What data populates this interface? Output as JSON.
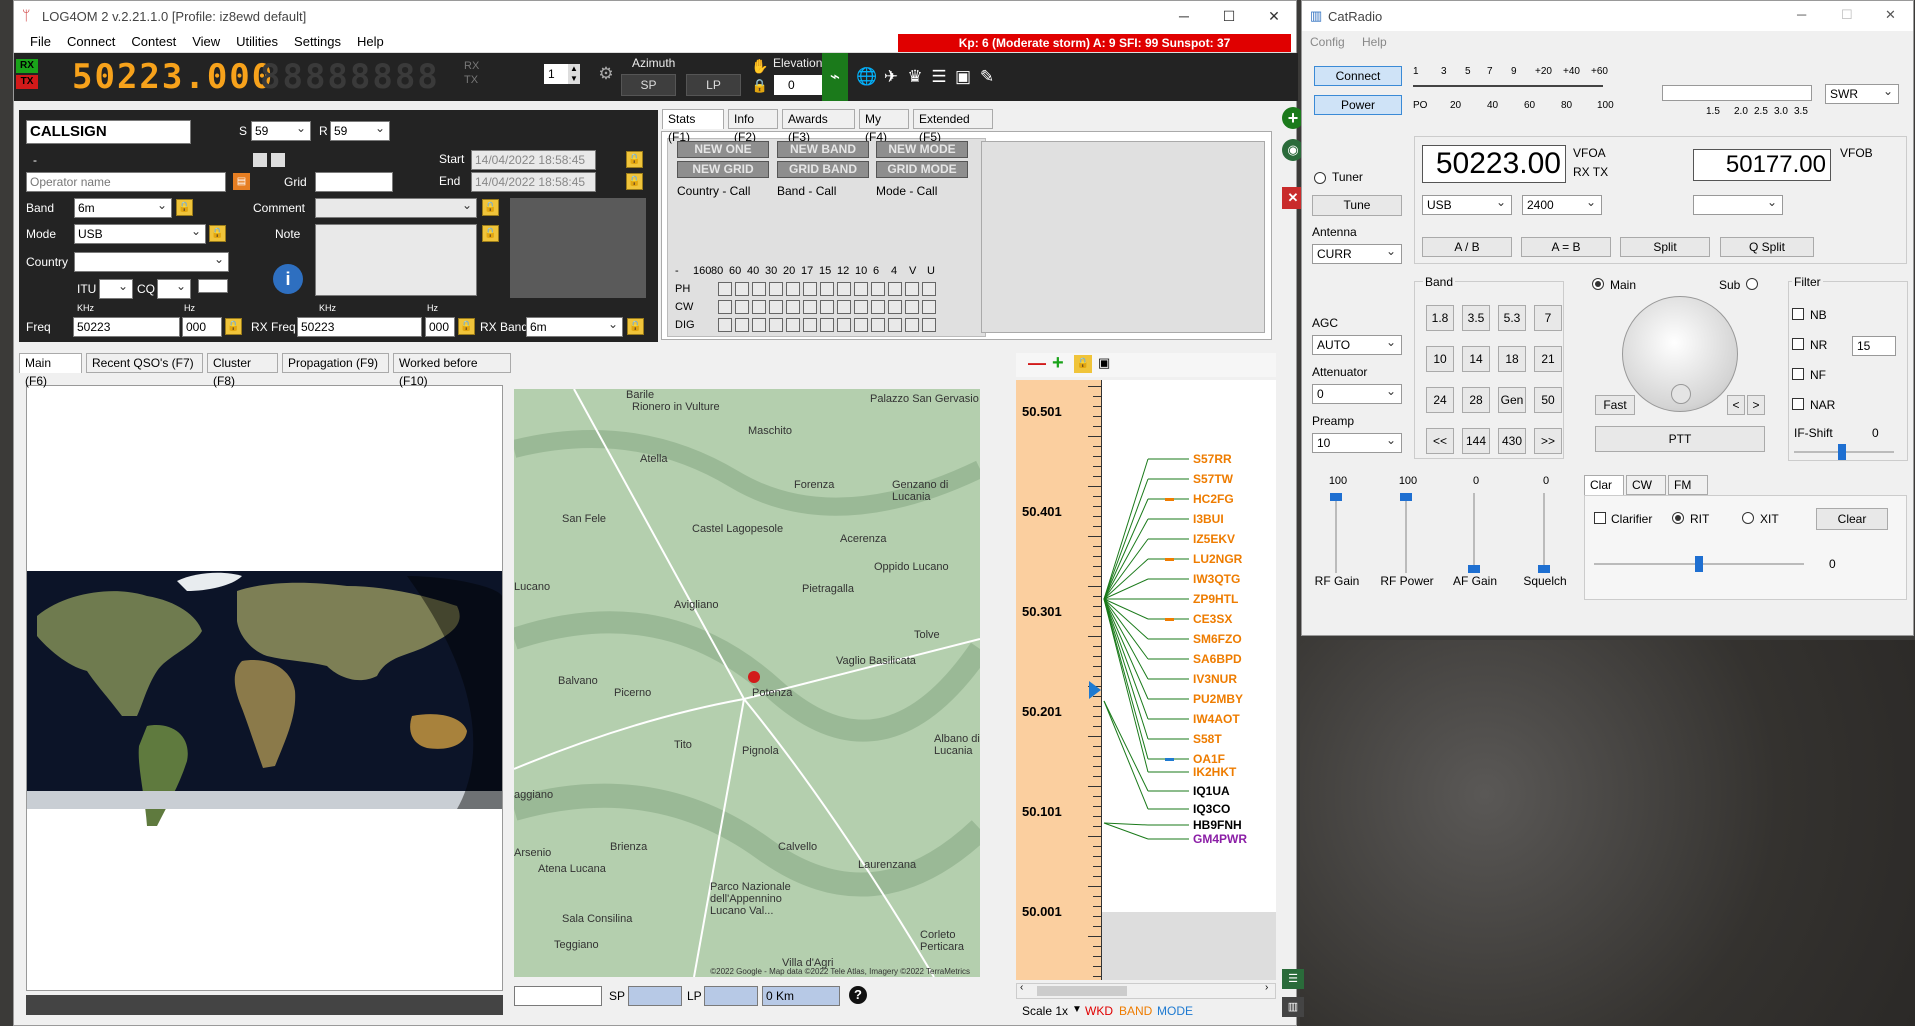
{
  "log": {
    "title": "LOG4OM 2 v.2.21.1.0 [Profile: iz8ewd default]",
    "menu": [
      "File",
      "Connect",
      "Contest",
      "View",
      "Utilities",
      "Settings",
      "Help"
    ],
    "kp_banner": "Kp: 6 (Moderate storm)  A: 9  SFI: 99 Sunspot: 37",
    "rx": "RX",
    "tx": "TX",
    "freq_display": "50223.000",
    "freq_display_off": "88888888",
    "rx2": "RX",
    "tx2": "TX",
    "stepper": "1",
    "azimuth_label": "Azimuth",
    "sp": "SP",
    "lp": "LP",
    "elevation_label": "Elevation",
    "elevation_value": "0",
    "callsign": "CALLSIGN",
    "s_label": "S",
    "s_value": "59",
    "r_label": "R",
    "r_value": "59",
    "dash": "-",
    "start_label": "Start",
    "start_value": "14/04/2022 18:58:45",
    "end_label": "End",
    "end_value": "14/04/2022 18:58:45",
    "operator_placeholder": "Operator name",
    "grid_label": "Grid",
    "band_label": "Band",
    "band_value": "6m",
    "comment_label": "Comment",
    "mode_label": "Mode",
    "mode_value": "USB",
    "note_label": "Note",
    "country_label": "Country",
    "itu_label": "ITU",
    "cq_label": "CQ",
    "khz": "KHz",
    "hz": "Hz",
    "freq_label": "Freq",
    "freq_value": "50223",
    "freq_hz": "000",
    "rxfreq_label": "RX Freq",
    "rxfreq_value": "50223",
    "rxfreq_hz": "000",
    "rxband_label": "RX Band",
    "rxband_value": "6m",
    "stats_tabs": [
      "Stats (F1)",
      "Info (F2)",
      "Awards (F3)",
      "My (F4)",
      "Extended (F5)"
    ],
    "new_buttons": [
      "NEW ONE",
      "NEW BAND",
      "NEW MODE",
      "NEW GRID",
      "GRID BAND",
      "GRID MODE"
    ],
    "call_labels": [
      "Country - Call",
      "Band - Call",
      "Mode - Call"
    ],
    "band_cols": [
      "-",
      "160",
      "80",
      "60",
      "40",
      "30",
      "20",
      "17",
      "15",
      "12",
      "10",
      "6",
      "4",
      "V",
      "U"
    ],
    "mode_rows": [
      "PH",
      "CW",
      "DIG"
    ],
    "main_tabs": [
      "Main (F6)",
      "Recent QSO's (F7)",
      "Cluster (F8)",
      "Propagation (F9)",
      "Worked before (F10)"
    ],
    "map_places": [
      "Barile",
      "Rionero in Vulture",
      "Atella",
      "Maschito",
      "Palazzo San Gervasio",
      "San Fele",
      "Forenza",
      "Genzano di Lucania",
      "Castel Lagopesole",
      "Acerenza",
      "Lucano",
      "Oppido Lucano",
      "Avigliano",
      "Pietragalla",
      "Tolve",
      "Vaglio Basilicata",
      "Potenza",
      "Picerno",
      "Balvano",
      "Tito",
      "Pignola",
      "Albano di Lucania",
      "aggiano",
      "Arsenio",
      "Brienza",
      "Calvello",
      "Atena Lucana",
      "Laurenzana",
      "Parco Nazionale dell'Appennino Lucano Val...",
      "Sala Consilina",
      "Teggiano",
      "Villa d'Agri",
      "Corleto Perticara"
    ],
    "map_credit": "©2022 Google - Map data ©2022 Tele Atlas, Imagery ©2022 TerraMetrics",
    "sp_label": "SP",
    "lp_label": "LP",
    "km": "0 Km",
    "bandmap_ticks": [
      "50.501",
      "50.401",
      "50.301",
      "50.201",
      "50.101",
      "50.001"
    ],
    "spots": [
      {
        "call": "S57RR",
        "color": "#ee7c00"
      },
      {
        "call": "S57TW",
        "color": "#ee7c00"
      },
      {
        "call": "HC2FG",
        "color": "#ee7c00"
      },
      {
        "call": "I3BUI",
        "color": "#ee7c00"
      },
      {
        "call": "IZ5EKV",
        "color": "#ee7c00"
      },
      {
        "call": "LU2NGR",
        "color": "#ee7c00"
      },
      {
        "call": "IW3QTG",
        "color": "#ee7c00"
      },
      {
        "call": "ZP9HTL",
        "color": "#ee7c00"
      },
      {
        "call": "CE3SX",
        "color": "#ee7c00"
      },
      {
        "call": "SM6FZO",
        "color": "#ee7c00"
      },
      {
        "call": "SA6BPD",
        "color": "#ee7c00"
      },
      {
        "call": "IV3NUR",
        "color": "#ee7c00"
      },
      {
        "call": "PU2MBY",
        "color": "#ee7c00"
      },
      {
        "call": "IW4AOT",
        "color": "#ee7c00"
      },
      {
        "call": "S58T",
        "color": "#ee7c00"
      },
      {
        "call": "OA1F",
        "color": "#ee7c00"
      },
      {
        "call": "IK2HKT",
        "color": "#ee7c00"
      },
      {
        "call": "IQ1UA",
        "color": "#000000"
      },
      {
        "call": "IQ3CO",
        "color": "#000000"
      },
      {
        "call": "HB9FNH",
        "color": "#000000"
      },
      {
        "call": "GM4PWR",
        "color": "#8b1ea6"
      }
    ],
    "scale": "Scale 1x",
    "wkd": "WKD",
    "band_legend": "BAND",
    "mode_legend": "MODE",
    "colors": {
      "wkd": "#e00000",
      "band": "#ee7c00",
      "mode": "#1e7ad1"
    }
  },
  "cat": {
    "title": "CatRadio",
    "menu": [
      "Config",
      "Help"
    ],
    "connect": "Connect",
    "power": "Power",
    "meter_top": [
      "1",
      "3",
      "5",
      "7",
      "9",
      "+20",
      "+40",
      "+60"
    ],
    "meter_bottom": [
      "PO",
      "20",
      "40",
      "60",
      "80",
      "100"
    ],
    "swr_ticks": [
      "1.5",
      "2.0",
      "2.5",
      "3.0",
      "3.5"
    ],
    "swr": "SWR",
    "tuner": "Tuner",
    "tune": "Tune",
    "antenna_label": "Antenna",
    "antenna_value": "CURR",
    "vfoa_value": "50223.00",
    "vfoa_label": "VFOA",
    "rxtx_label": "RX TX",
    "vfob_value": "50177.00",
    "vfob_label": "VFOB",
    "mode_value": "USB",
    "bw_value": "2400",
    "ab_buttons": [
      "A / B",
      "A = B",
      "Split",
      "Q Split"
    ],
    "agc_label": "AGC",
    "agc_value": "AUTO",
    "att_label": "Attenuator",
    "att_value": "0",
    "preamp_label": "Preamp",
    "preamp_value": "10",
    "band_label": "Band",
    "band_buttons": [
      "1.8",
      "3.5",
      "5.3",
      "7",
      "10",
      "14",
      "18",
      "21",
      "24",
      "28",
      "Gen",
      "50",
      "<<",
      "144",
      "430",
      ">>"
    ],
    "main": "Main",
    "sub": "Sub",
    "fast": "Fast",
    "lt": "<",
    "gt": ">",
    "ptt": "PTT",
    "filter_label": "Filter",
    "filters": [
      "NB",
      "NR",
      "NF",
      "NAR"
    ],
    "nr_value": "15",
    "ifshift_label": "IF-Shift",
    "ifshift_value": "0",
    "gains": [
      {
        "label": "RF Gain",
        "value": "100",
        "level": 1.0
      },
      {
        "label": "RF Power",
        "value": "100",
        "level": 1.0
      },
      {
        "label": "AF Gain",
        "value": "0",
        "level": 0.0
      },
      {
        "label": "Squelch",
        "value": "0",
        "level": 0.0
      }
    ],
    "clar_tabs": [
      "Clar",
      "CW",
      "FM"
    ],
    "clarifier": "Clarifier",
    "rit": "RIT",
    "xit": "XIT",
    "clear": "Clear",
    "clar_value": "0"
  }
}
